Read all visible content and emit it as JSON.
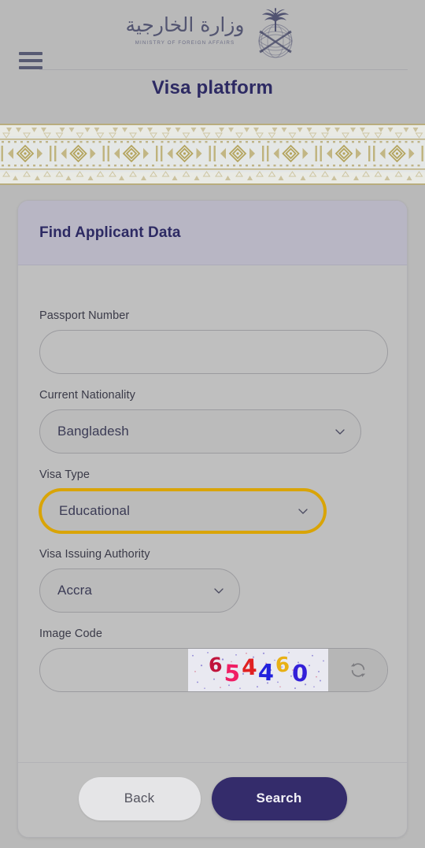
{
  "header": {
    "menu_icon": "hamburger-menu-icon",
    "logo_arabic": "وزارة الخارجية",
    "logo_english": "MINISTRY OF FOREIGN AFFAIRS",
    "emblem_icon": "saudi-emblem-palm-swords-icon",
    "page_title": "Visa platform"
  },
  "ornament": {
    "name": "decorative-pattern-band",
    "colors": {
      "background": "#e8e9e2",
      "motif": "#b9ad7e",
      "border": "#b9ad7e"
    }
  },
  "card": {
    "title": "Find Applicant Data",
    "fields": [
      {
        "key": "passport_number",
        "label": "Passport Number",
        "type": "text",
        "value": "",
        "placeholder": "",
        "focused": false
      },
      {
        "key": "current_nationality",
        "label": "Current Nationality",
        "type": "select",
        "value": "Bangladesh",
        "focused": false
      },
      {
        "key": "visa_type",
        "label": "Visa Type",
        "type": "select",
        "value": "Educational",
        "focused": true
      },
      {
        "key": "visa_issuing_authority",
        "label": "Visa Issuing Authority",
        "type": "select",
        "value": "Accra",
        "focused": false
      }
    ],
    "captcha": {
      "label": "Image Code",
      "value": "",
      "placeholder": "",
      "code": "654460",
      "digit_colors": [
        "#c0143c",
        "#f01e64",
        "#e02020",
        "#2222dd",
        "#e8b014",
        "#3320d8"
      ],
      "refresh_icon": "refresh-icon"
    },
    "buttons": {
      "back": "Back",
      "search": "Search"
    }
  },
  "colors": {
    "page_background": "#b9b9b9",
    "card_background": "#bfbfbf",
    "card_header": "#b8b6c4",
    "brand_navy": "#2d2a63",
    "focus_gold": "#d9a407",
    "primary_button": "#342c6b"
  }
}
